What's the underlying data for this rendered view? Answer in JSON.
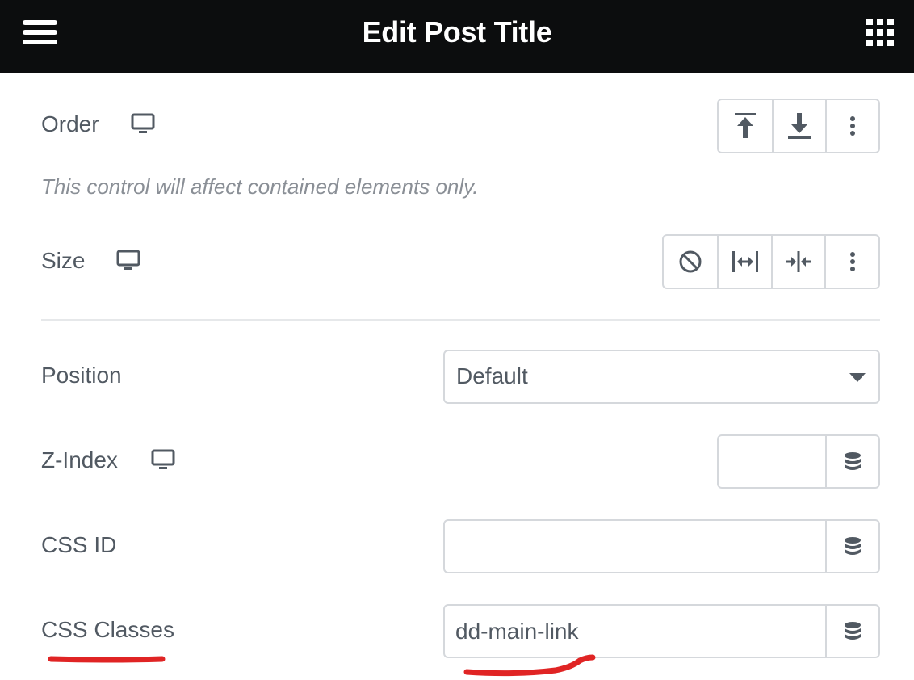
{
  "header": {
    "title": "Edit Post Title",
    "menu_icon": "hamburger-menu-icon",
    "widgets_icon": "grid-apps-icon",
    "background": "#0c0d0e"
  },
  "order": {
    "label": "Order",
    "responsive_icon": "desktop-monitor-icon",
    "buttons": [
      "align-top-icon",
      "align-bottom-icon",
      "more-vertical-icon"
    ],
    "note": "This control will affect contained elements only."
  },
  "size": {
    "label": "Size",
    "responsive_icon": "desktop-monitor-icon",
    "buttons": [
      "none-icon",
      "grow-icon",
      "shrink-icon",
      "more-vertical-icon"
    ]
  },
  "position": {
    "label": "Position",
    "value": "Default"
  },
  "z_index": {
    "label": "Z-Index",
    "responsive_icon": "desktop-monitor-icon",
    "value": ""
  },
  "css_id": {
    "label": "CSS ID",
    "value": ""
  },
  "css_classes": {
    "label": "CSS Classes",
    "value": "dd-main-link"
  },
  "colors": {
    "text": "#515962",
    "border": "#d5d8dc",
    "annotation": "#e02424"
  }
}
